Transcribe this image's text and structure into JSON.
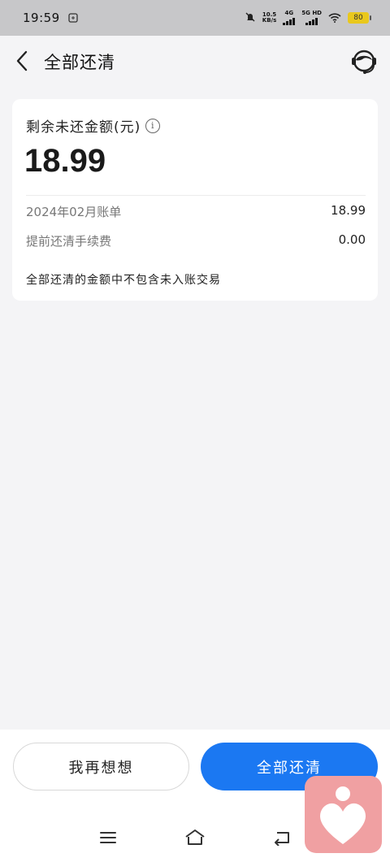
{
  "status_bar": {
    "time": "19:59",
    "net_speed_top": "10.5",
    "net_speed_bottom": "KB/s",
    "sig1_label": "4G",
    "sig2_label": "5G HD",
    "battery": "80"
  },
  "header": {
    "title": "全部还清"
  },
  "card": {
    "label": "剩余未还金额(元)",
    "amount": "18.99",
    "rows": [
      {
        "label": "2024年02月账单",
        "value": "18.99"
      },
      {
        "label": "提前还清手续费",
        "value": "0.00"
      }
    ],
    "note": "全部还清的金额中不包含未入账交易"
  },
  "actions": {
    "think_label": "我再想想",
    "pay_label": "全部还清"
  },
  "colors": {
    "primary": "#1b78f2",
    "background": "#f4f4f6",
    "status_bar": "#c7c7c9",
    "battery": "#e9c81d",
    "badge": "#f0a0a2"
  },
  "icons": [
    "back-arrow-icon",
    "customer-service-icon",
    "info-icon",
    "menu-icon",
    "home-icon",
    "back-nav-icon",
    "heart-person-icon"
  ]
}
